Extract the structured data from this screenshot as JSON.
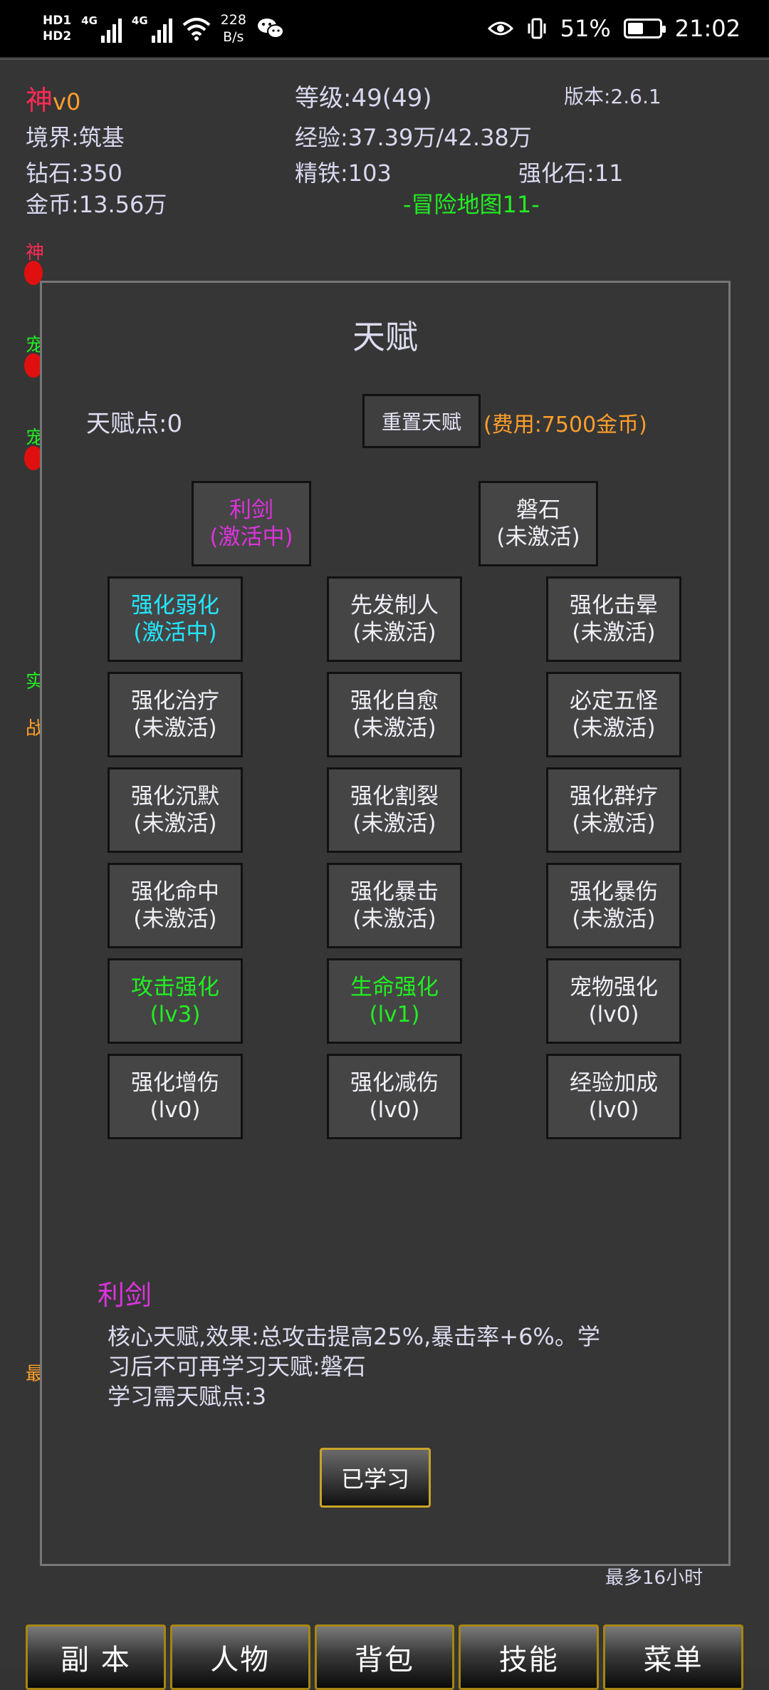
{
  "status_bar": {
    "hd1": "HD1",
    "hd2": "HD2",
    "sig1": "4G",
    "sig2": "4G",
    "speed_value": "228",
    "speed_unit": "B/s",
    "battery": "51%",
    "battery_level": 0.51,
    "time": "21:02"
  },
  "header": {
    "name": "神",
    "vip": "v0",
    "level": "等级:49(49)",
    "version": "版本:2.6.1",
    "realm": "境界:筑基",
    "exp": "经验:37.39万/42.38万",
    "diamond": "钻石:350",
    "iron": "精铁:103",
    "stone": "强化石:11",
    "gold": "金币:13.56万",
    "map": "-冒险地图11-"
  },
  "talent": {
    "title": "天赋",
    "points": "天赋点:0",
    "reset_label": "重置天赋",
    "cost": "(费用:7500金币)",
    "core": [
      {
        "name": "利剑",
        "state": "(激活中)"
      },
      {
        "name": "磐石",
        "state": "(未激活)"
      }
    ],
    "grid": [
      {
        "name": "强化弱化",
        "state": "(激活中)"
      },
      {
        "name": "先发制人",
        "state": "(未激活)"
      },
      {
        "name": "强化击晕",
        "state": "(未激活)"
      },
      {
        "name": "强化治疗",
        "state": "(未激活)"
      },
      {
        "name": "强化自愈",
        "state": "(未激活)"
      },
      {
        "name": "必定五怪",
        "state": "(未激活)"
      },
      {
        "name": "强化沉默",
        "state": "(未激活)"
      },
      {
        "name": "强化割裂",
        "state": "(未激活)"
      },
      {
        "name": "强化群疗",
        "state": "(未激活)"
      },
      {
        "name": "强化命中",
        "state": "(未激活)"
      },
      {
        "name": "强化暴击",
        "state": "(未激活)"
      },
      {
        "name": "强化暴伤",
        "state": "(未激活)"
      },
      {
        "name": "攻击强化",
        "state": "(lv3)"
      },
      {
        "name": "生命强化",
        "state": "(lv1)"
      },
      {
        "name": "宠物强化",
        "state": "(lv0)"
      },
      {
        "name": "强化增伤",
        "state": "(lv0)"
      },
      {
        "name": "强化减伤",
        "state": "(lv0)"
      },
      {
        "name": "经验加成",
        "state": "(lv0)"
      }
    ],
    "detail_name": "利剑",
    "detail_line1": "核心天赋,效果:总攻击提高25%,暴击率+6%。学",
    "detail_line2": "习后不可再学习天赋:磐石",
    "detail_line3": "学习需天赋点:3",
    "learned_label": "已学习"
  },
  "side": {
    "c1": "神",
    "c2": "宠",
    "c3": "宠",
    "c4": "实",
    "c5": "战",
    "c6": "最"
  },
  "max_hours": "最多16小时",
  "nav": {
    "dungeon": "副 本",
    "character": "人物",
    "bag": "背包",
    "skills": "技能",
    "menu": "菜单"
  },
  "colors": {
    "accent_red": "#ff2a55",
    "active_magenta": "#dd33dd",
    "active_cyan": "#22e8ff",
    "level_green": "#22ee22",
    "cost_orange": "#ff9f2b",
    "nav_border": "#a8860e"
  }
}
